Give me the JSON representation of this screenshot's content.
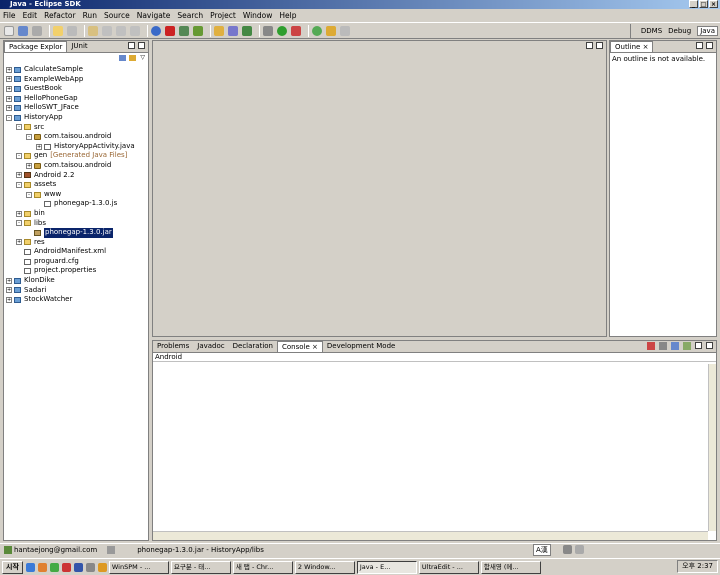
{
  "window": {
    "title": "Java - Eclipse SDK"
  },
  "menu": [
    "File",
    "Edit",
    "Refactor",
    "Run",
    "Source",
    "Navigate",
    "Search",
    "Project",
    "Window",
    "Help"
  ],
  "perspectives": [
    "DDMS",
    "Debug",
    "Java"
  ],
  "explorer": {
    "tabs": [
      "Package Explor",
      "JUnit"
    ],
    "tree": [
      {
        "label": "CalculateSample",
        "kind": "proj",
        "depth": 0,
        "exp": "+"
      },
      {
        "label": "ExampleWebApp",
        "kind": "proj",
        "depth": 0,
        "exp": "+"
      },
      {
        "label": "GuestBook",
        "kind": "proj",
        "depth": 0,
        "exp": "+"
      },
      {
        "label": "HelloPhoneGap",
        "kind": "proj",
        "depth": 0,
        "exp": "+"
      },
      {
        "label": "HelloSWT_JFace",
        "kind": "proj",
        "depth": 0,
        "exp": "+"
      },
      {
        "label": "HistoryApp",
        "kind": "proj",
        "depth": 0,
        "exp": "-"
      },
      {
        "label": "src",
        "kind": "folder",
        "depth": 1,
        "exp": "-"
      },
      {
        "label": "com.taisou.android",
        "kind": "pkg",
        "depth": 2,
        "exp": "-"
      },
      {
        "label": "HistoryAppActivity.java",
        "kind": "file",
        "depth": 3,
        "exp": "+"
      },
      {
        "label": "gen",
        "extra": "[Generated Java Files]",
        "kind": "folder",
        "depth": 1,
        "exp": "-"
      },
      {
        "label": "com.taisou.android",
        "kind": "pkg",
        "depth": 2,
        "exp": "+"
      },
      {
        "label": "Android 2.2",
        "kind": "lib",
        "depth": 1,
        "exp": "+"
      },
      {
        "label": "assets",
        "kind": "folder",
        "depth": 1,
        "exp": "-"
      },
      {
        "label": "www",
        "kind": "folder",
        "depth": 2,
        "exp": "-"
      },
      {
        "label": "phonegap-1.3.0.js",
        "kind": "file",
        "depth": 3,
        "exp": ""
      },
      {
        "label": "bin",
        "kind": "folder",
        "depth": 1,
        "exp": "+"
      },
      {
        "label": "libs",
        "kind": "folder",
        "depth": 1,
        "exp": "-"
      },
      {
        "label": "phonegap-1.3.0.jar",
        "kind": "jar",
        "depth": 2,
        "exp": "",
        "selected": true
      },
      {
        "label": "res",
        "kind": "folder",
        "depth": 1,
        "exp": "+"
      },
      {
        "label": "AndroidManifest.xml",
        "kind": "file",
        "depth": 1,
        "exp": ""
      },
      {
        "label": "proguard.cfg",
        "kind": "file",
        "depth": 1,
        "exp": ""
      },
      {
        "label": "project.properties",
        "kind": "file",
        "depth": 1,
        "exp": ""
      },
      {
        "label": "KlonDike",
        "kind": "proj",
        "depth": 0,
        "exp": "+"
      },
      {
        "label": "Sadari",
        "kind": "proj",
        "depth": 0,
        "exp": "+"
      },
      {
        "label": "StockWatcher",
        "kind": "proj",
        "depth": 0,
        "exp": "+"
      }
    ]
  },
  "outline": {
    "tab": "Outline",
    "message": "An outline is not available."
  },
  "bottom": {
    "tabs": [
      "Problems",
      "Javadoc",
      "Declaration",
      "Console",
      "Development Mode"
    ],
    "active": "Console",
    "console_name": "Android"
  },
  "status": {
    "user": "hantaejong@gmail.com",
    "selection": "phonegap-1.3.0.jar - HistoryApp/libs",
    "ime": "A漢"
  },
  "taskbar": {
    "start": "시작",
    "tasks": [
      "WinSPM - ...",
      "요구분 - 태...",
      "새 탭 - Chr...",
      "2 Window...",
      "Java - E...",
      "UltraEdit - ...",
      "함새영 (메..."
    ],
    "active": "Java - E...",
    "clock": "오후 2:37"
  },
  "colors": {
    "title_start": "#0a246a",
    "title_end": "#a6caf0",
    "selection": "#0a246a",
    "chrome": "#d4d0c8"
  }
}
